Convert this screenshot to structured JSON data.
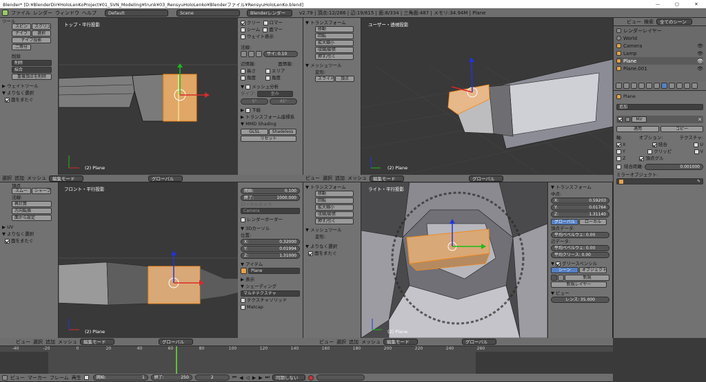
{
  "title": "Blender* [D:¥BlenderDir¥HoloLenKoProject¥01_SVN_Modeling¥trunk¥03_RensyuHoloLenko¥Blenderファイル¥RensyuHoloLenKo.blend]",
  "info": {
    "menu": [
      "ファイル",
      "レンダー",
      "ウィンドウ",
      "ヘルプ"
    ],
    "layout": "Default",
    "scene": "Scene",
    "engine": "Blenderレンダー",
    "stats": "v2.79 | 頂点:12/286 | 辺:19/615 | 面:8/334 | 三角面:487 | メモリ:34.94M | Plane"
  },
  "views": {
    "top": {
      "name": "トップ・平行投影",
      "obj": "(2) Plane"
    },
    "user": {
      "name": "ユーザー・透視投影",
      "obj": "(2) Plane"
    },
    "front": {
      "name": "フロント・平行投影",
      "obj": "(2) Plane"
    },
    "right": {
      "name": "ライト・平行投影",
      "obj": "(2) Plane"
    }
  },
  "tools_top": {
    "header": "ツール",
    "btns": [
      "スピン",
      "スクリュ",
      "ナイフ",
      "選択",
      "ナイフ投影",
      "二等分"
    ],
    "remove_header": "削除",
    "remove_sel": "削除",
    "merge_sel": "結合",
    "remove_doubles": "重複頂点を削除",
    "weight_tools": "ウェイトツール",
    "last_op": "よりなく選択",
    "face_through": "面をまたぐ"
  },
  "tools_bottom": {
    "header": "頂点",
    "btns": [
      "スムー",
      "シャープ"
    ],
    "normals": "法線:",
    "recalc": "再計算",
    "flip": "方向転換",
    "set_from_faces": "面から設定",
    "uv": "UV",
    "last_op": "よりなく選択",
    "face_through": "面をまたぐ"
  },
  "n_top": {
    "checks": [
      [
        "クリー",
        "ロマー"
      ],
      [
        "シーム",
        "面マー"
      ]
    ],
    "weight": "ウェイト表示",
    "normals": "法線:",
    "size": "サイ: 0.10",
    "edge_label": "辺情報:",
    "face_label": "面情報:",
    "edge_checks": [
      "長さ",
      "角度"
    ],
    "face_checks": [
      "エリア",
      "角度"
    ],
    "mesh_analysis": "メッシュ分析",
    "type": "タイプ:",
    "type_val": "歪み",
    "range_min": "5°",
    "range_max": "45°",
    "lower": "下絵",
    "transform_orient": "トランスフォーム座標系",
    "mmd": "MMD Shading",
    "glsl": "GLSL",
    "shadeless": "Shadeless",
    "reset": "リセット"
  },
  "n_bottom": {
    "start_label": "開始:",
    "start_val": "0.100",
    "end_label": "終了:",
    "end_val": "1000.000",
    "local_camera": "ローカルカメラ",
    "camera": "Camera",
    "render_border": "レンダーボーダー",
    "cursor": "3Dカーソル",
    "position": "位置:",
    "x": "0.32000",
    "y": "0.01994",
    "z": "1.31000",
    "item": "アイテム",
    "item_name": "Plane",
    "display": "表示",
    "shading": "シェーディング",
    "matcap_mode": "マルチテクスチャ",
    "textured_solid": "テクスチャソリッド",
    "matcap": "Matcap"
  },
  "t_user": {
    "transform": "トランスフォーム",
    "btns": [
      "移動",
      "回転",
      "拡大縮小",
      "収縮/膨張",
      "押す/引く"
    ],
    "mesh_tools": "メッシュツール",
    "deform": "変形:",
    "slide": "スライド",
    "vert": "頂点"
  },
  "t_right": {
    "transform": "トランスフォーム",
    "btns": [
      "移動",
      "回転",
      "拡大縮小",
      "収縮/膨張",
      "押す/引く"
    ],
    "mesh_tools": "メッシュツール",
    "deform": "変形:",
    "last_op": "よりなく選択",
    "face_through": "面をまたぐ"
  },
  "n_right": {
    "transform": "トランスフォーム",
    "median": "中点:",
    "x": "0.59203",
    "y": "0.01764",
    "z": "1.31140",
    "global": "グローバル",
    "local": "ローカル",
    "vert_data": "頂点データ:",
    "bevel_w": "平均ベベルウェ: 0.00",
    "edge_data": "辺データ:",
    "edge_bevel": "平均ベベルウェ: 0.00",
    "crease": "平均クリース: 0.00",
    "grease": "グリースペンシル",
    "scene": "シーン",
    "object": "オブジェクト",
    "new": "新規",
    "new_layer": "新規レイヤー",
    "view": "ビュー",
    "lens": "レンズ: 35.000"
  },
  "outliner": {
    "tabs": [
      "ビュー",
      "検索",
      "全てのシーン"
    ],
    "items": [
      "レンダーレイヤー",
      "World",
      "Camera",
      "Lamp",
      "Plane",
      "Plane.001"
    ]
  },
  "props": {
    "object": "Plane",
    "add": "追加",
    "modifier": "Mir",
    "apply": "適用",
    "copy": "コピー",
    "axis": "軸:",
    "options": "オプション:",
    "texture": "テクスチャ:",
    "x": "X",
    "y": "Y",
    "z": "Z",
    "merge": "結合",
    "clip": "クリッピ",
    "vgroup": "頂点グル",
    "u": "U",
    "v": "V",
    "merge_limit": "結合距離:",
    "merge_val": "0.001000",
    "mirror_obj": "ミラーオブジェクト:"
  },
  "vp_header": {
    "view": "ビュー",
    "select": "選択",
    "add": "追加",
    "mesh": "メッシュ",
    "mode": "編集モード",
    "global": "グローバル"
  },
  "timeline": {
    "ticks": [
      "-40",
      "-20",
      "0",
      "20",
      "40",
      "60",
      "80",
      "100",
      "120",
      "140",
      "160",
      "180",
      "200",
      "220",
      "240",
      "260"
    ],
    "view": "ビュー",
    "marker": "マーカー",
    "frame": "フレーム",
    "playback": "再生",
    "start": "開始:",
    "start_val": "1",
    "end": "終了:",
    "end_val": "250",
    "current": "2",
    "sync": "同期しない"
  }
}
